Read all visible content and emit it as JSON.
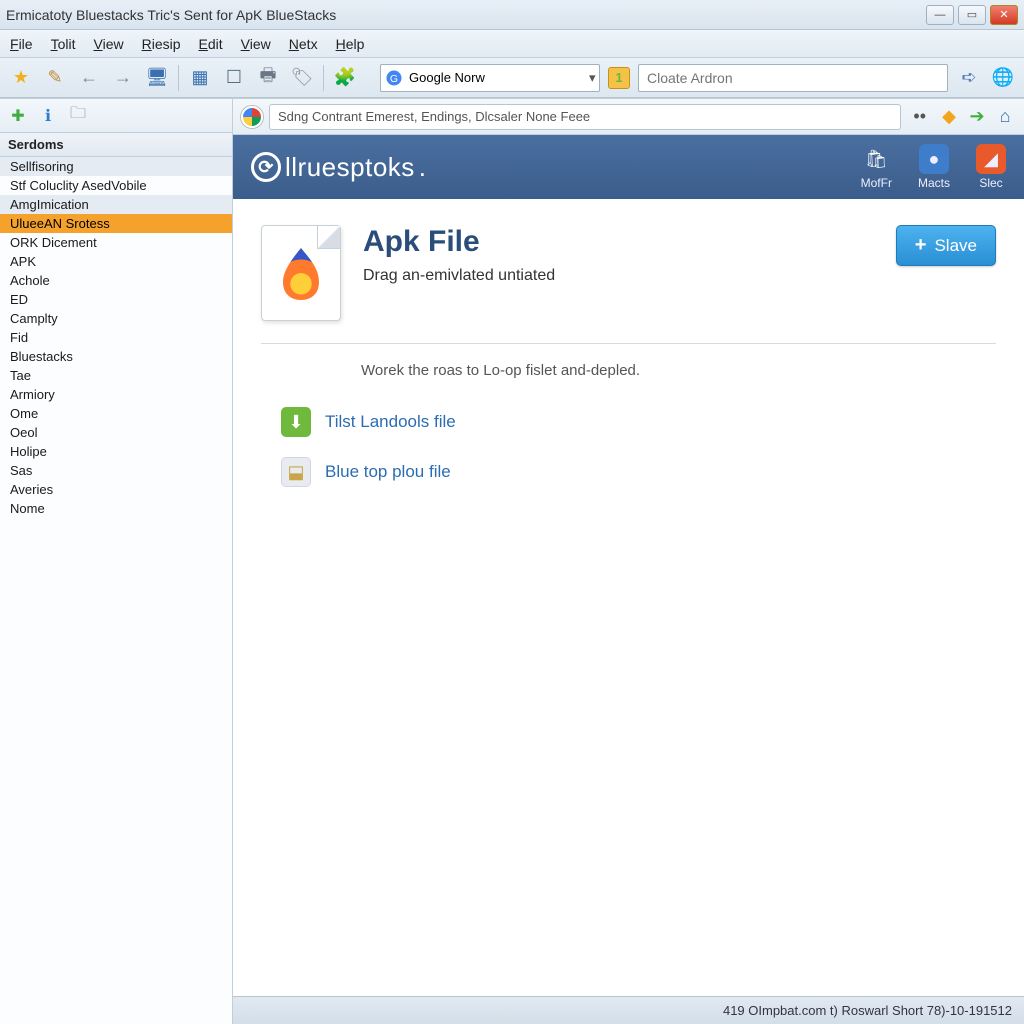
{
  "title": "Ermicatoty Bluestacks Tric's Sent for ApK BlueStacks",
  "menu": [
    "File",
    "Tolit",
    "View",
    "Riesip",
    "Edit",
    "View",
    "Netx",
    "Help"
  ],
  "toolbar": {
    "search_engine": "Google Norw",
    "badge": "1",
    "address_placeholder": "Cloate Ardron"
  },
  "sidebar": {
    "header": "Serdoms",
    "items": [
      {
        "label": "Sellfisoring",
        "cls": "hl1"
      },
      {
        "label": "Stf Coluclity AsedVobile",
        "cls": ""
      },
      {
        "label": "AmgImication",
        "cls": "hl1"
      },
      {
        "label": "UlueeAN Srotess",
        "cls": "sel"
      },
      {
        "label": "ORK Dicement",
        "cls": ""
      },
      {
        "label": "APK",
        "cls": ""
      },
      {
        "label": "Achole",
        "cls": ""
      },
      {
        "label": "ED",
        "cls": ""
      },
      {
        "label": "Camplty",
        "cls": ""
      },
      {
        "label": "Fid",
        "cls": ""
      },
      {
        "label": "Bluestacks",
        "cls": ""
      },
      {
        "label": "Tae",
        "cls": ""
      },
      {
        "label": "Armiory",
        "cls": ""
      },
      {
        "label": "Ome",
        "cls": ""
      },
      {
        "label": "Oeol",
        "cls": ""
      },
      {
        "label": "Holipe",
        "cls": ""
      },
      {
        "label": "Sas",
        "cls": ""
      },
      {
        "label": "Averies",
        "cls": ""
      },
      {
        "label": "Nome",
        "cls": ""
      }
    ]
  },
  "tab": {
    "label": "Sdng Contrant Emerest, Endings, Dlcsaler None Feee"
  },
  "brand": {
    "name": "llruesptoks",
    "actions": [
      {
        "label": "MofFr",
        "cls": "white",
        "glyph": "🛍"
      },
      {
        "label": "Macts",
        "cls": "blue",
        "glyph": "●"
      },
      {
        "label": "Slec",
        "cls": "orange",
        "glyph": "◢"
      }
    ]
  },
  "hero": {
    "title": "Apk File",
    "subtitle": "Drag an-emivlated untiated",
    "button": "Slave"
  },
  "desc": "Worek the roas to Lo-op fislet and-depled.",
  "links": [
    {
      "label": "Tilst Landools file",
      "cls": "green",
      "glyph": "⬇"
    },
    {
      "label": "Blue top plou file",
      "cls": "shield",
      "glyph": "⬓"
    }
  ],
  "status": "419 OImpbat.com t) Roswarl Short 78)-10-191512"
}
